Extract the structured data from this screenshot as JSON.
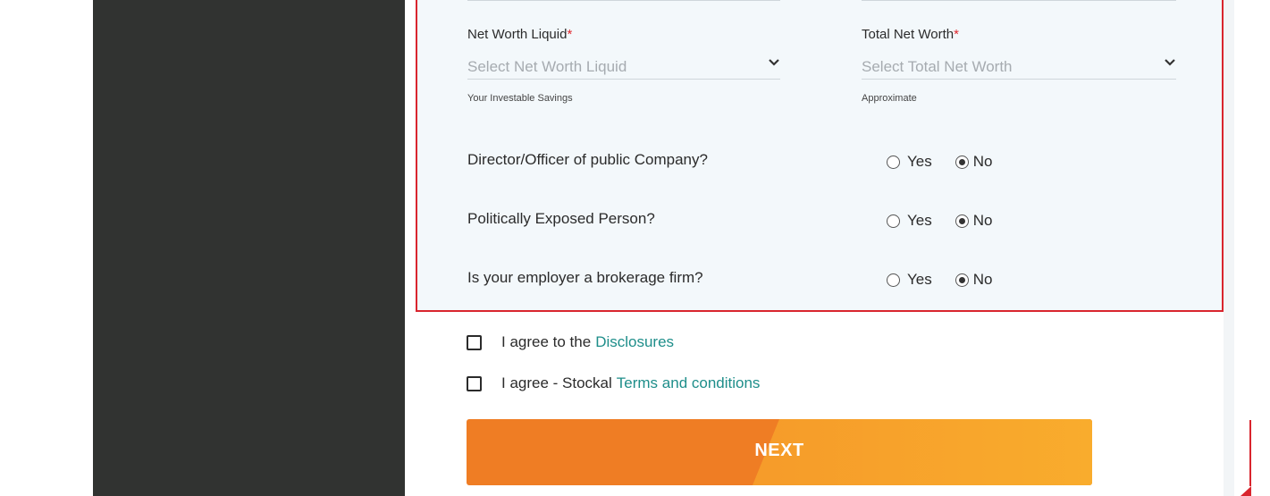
{
  "colors": {
    "accent": "#ef7d24",
    "border": "#d9252e",
    "link": "#1e8e8a",
    "panel": "#313331"
  },
  "fields": {
    "net_worth_liquid": {
      "label": "Net Worth Liquid",
      "required_mark": "*",
      "placeholder": "Select Net Worth Liquid",
      "hint": "Your Investable Savings"
    },
    "total_net_worth": {
      "label": "Total Net Worth",
      "required_mark": "*",
      "placeholder": "Select Total Net Worth",
      "hint": "Approximate"
    }
  },
  "questions": [
    {
      "text": "Director/Officer of public Company?",
      "yes_label": "Yes",
      "no_label": "No",
      "selected": "No"
    },
    {
      "text": "Politically Exposed Person?",
      "yes_label": "Yes",
      "no_label": "No",
      "selected": "No"
    },
    {
      "text": "Is your employer a brokerage firm?",
      "yes_label": "Yes",
      "no_label": "No",
      "selected": "No"
    }
  ],
  "agreements": [
    {
      "prefix": "I agree to the",
      "link": "Disclosures",
      "checked": false
    },
    {
      "prefix": "I agree - Stockal",
      "link": "Terms and conditions",
      "checked": false
    }
  ],
  "next_button": {
    "label": "NEXT"
  },
  "icons": {
    "dropdown": "chevron-down-icon"
  }
}
